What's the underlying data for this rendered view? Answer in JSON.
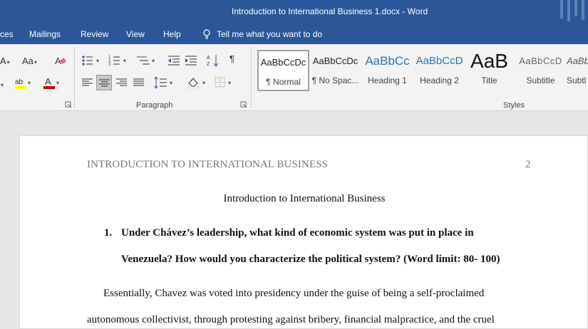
{
  "window": {
    "title": "Introduction to International Business 1.docx  -  Word"
  },
  "menu": {
    "items": [
      {
        "id": "references",
        "label": "ces"
      },
      {
        "id": "mailings",
        "label": "Mailings"
      },
      {
        "id": "review",
        "label": "Review"
      },
      {
        "id": "view",
        "label": "View"
      },
      {
        "id": "help",
        "label": "Help"
      }
    ],
    "tell_me": "Tell me what you want to do"
  },
  "ribbon": {
    "paragraph_label": "Paragraph",
    "styles_label": "Styles",
    "font_case": "Aa",
    "styles": [
      {
        "sample": "AaBbCcDc",
        "name": "¶ Normal",
        "selected": true
      },
      {
        "sample": "AaBbCcDc",
        "name": "¶ No Spac...",
        "selected": false
      },
      {
        "sample": "AaBbCc",
        "name": "Heading 1",
        "selected": false
      },
      {
        "sample": "AaBbCcD",
        "name": "Heading 2",
        "selected": false
      },
      {
        "sample": "AaB",
        "name": "Title",
        "selected": false
      },
      {
        "sample": "AaBbCcD",
        "name": "Subtitle",
        "selected": false
      },
      {
        "sample": "AaBb",
        "name": "Subtl",
        "selected": false
      }
    ],
    "colors": {
      "highlight": "#ffff00",
      "font_color": "#c00000"
    }
  },
  "document": {
    "running_header": "INTRODUCTION TO INTERNATIONAL BUSINESS",
    "page_number": "2",
    "title": "Introduction to International Business",
    "question_number": "1.",
    "question_line1": "Under Chávez’s leadership, what kind of economic system was put in place in",
    "question_line2": "Venezuela? How would you characterize the political system? (Word limit: 80- 100)",
    "para_line1": "Essentially, Chavez was voted into presidency under the guise of being a self-proclaimed",
    "para_line2": "autonomous collectivist, through protesting against bribery, financial malpractice, and the cruel"
  }
}
